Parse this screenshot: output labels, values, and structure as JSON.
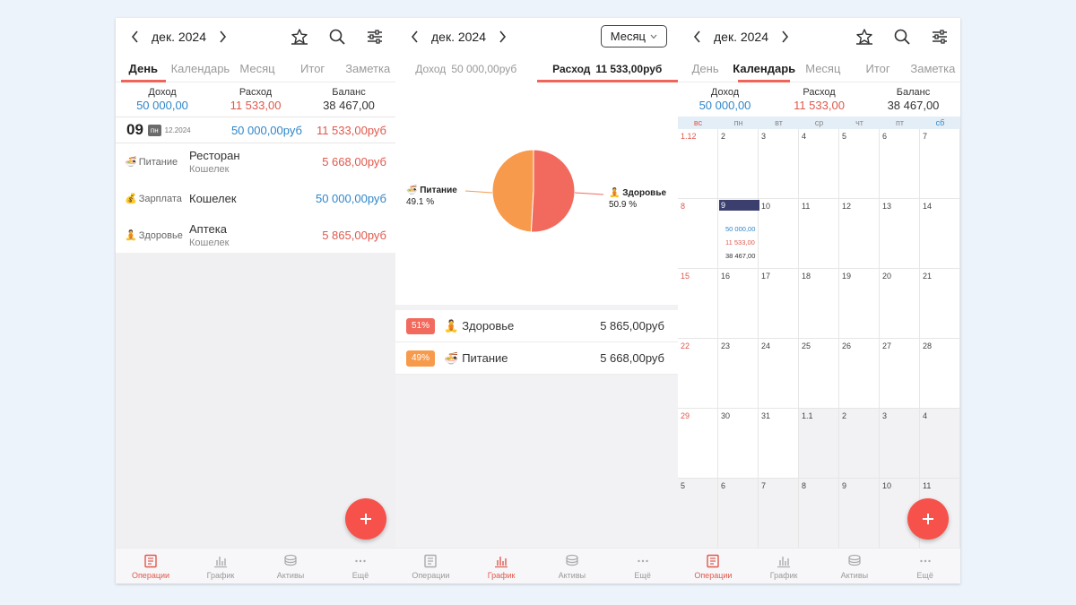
{
  "s1": {
    "month": "дек. 2024",
    "tabs": [
      "День",
      "Календарь",
      "Месяц",
      "Итог",
      "Заметка"
    ],
    "summary": {
      "income_label": "Доход",
      "income": "50 000,00",
      "expense_label": "Расход",
      "expense": "11 533,00",
      "balance_label": "Баланс",
      "balance": "38 467,00"
    },
    "day": {
      "num": "09",
      "weekday": "пн",
      "date": "12.2024",
      "income": "50 000,00руб",
      "expense": "11 533,00руб"
    },
    "transactions": [
      {
        "emoji": "🍜",
        "category": "Питание",
        "title": "Ресторан",
        "account": "Кошелек",
        "amount": "5 668,00руб",
        "type": "expense"
      },
      {
        "emoji": "💰",
        "category": "Зарплата",
        "title": "Кошелек",
        "account": "",
        "amount": "50 000,00руб",
        "type": "income"
      },
      {
        "emoji": "🧘",
        "category": "Здоровье",
        "title": "Аптека",
        "account": "Кошелек",
        "amount": "5 865,00руб",
        "type": "expense"
      }
    ]
  },
  "s2": {
    "month": "дек. 2024",
    "period": "Месяц",
    "income_tab_label": "Доход",
    "income_tab_value": "50 000,00руб",
    "expense_tab_label": "Расход",
    "expense_tab_value": "11 533,00руб",
    "pie": [
      {
        "emoji": "🍜",
        "name": "Питание",
        "pct_label": "49.1 %",
        "value": 49.1,
        "color": "#f79a4c"
      },
      {
        "emoji": "🧘",
        "name": "Здоровье",
        "pct_label": "50.9 %",
        "value": 50.9,
        "color": "#f26a5e"
      }
    ],
    "categories": [
      {
        "pct": "51%",
        "emoji": "🧘",
        "name": "Здоровье",
        "amount": "5 865,00руб",
        "color": "#f26a5e"
      },
      {
        "pct": "49%",
        "emoji": "🍜",
        "name": "Питание",
        "amount": "5 668,00руб",
        "color": "#f79a4c"
      }
    ]
  },
  "s3": {
    "month": "дек. 2024",
    "tabs": [
      "День",
      "Календарь",
      "Месяц",
      "Итог",
      "Заметка"
    ],
    "summary": {
      "income_label": "Доход",
      "income": "50 000,00",
      "expense_label": "Расход",
      "expense": "11 533,00",
      "balance_label": "Баланс",
      "balance": "38 467,00"
    },
    "weekdays": [
      "вс",
      "пн",
      "вт",
      "ср",
      "чт",
      "пт",
      "сб"
    ],
    "weeks": [
      [
        "1.12",
        "2",
        "3",
        "4",
        "5",
        "6",
        "7"
      ],
      [
        "8",
        "9",
        "10",
        "11",
        "12",
        "13",
        "14"
      ],
      [
        "15",
        "16",
        "17",
        "18",
        "19",
        "20",
        "21"
      ],
      [
        "22",
        "23",
        "24",
        "25",
        "26",
        "27",
        "28"
      ],
      [
        "29",
        "30",
        "31",
        "1.1",
        "2",
        "3",
        "4"
      ],
      [
        "5",
        "6",
        "7",
        "8",
        "9",
        "10",
        "11"
      ]
    ],
    "selected_day": {
      "income": "50 000,00",
      "expense": "11 533,00",
      "balance": "38 467,00"
    }
  },
  "nav": [
    "Операции",
    "График",
    "Активы",
    "Ещё"
  ],
  "colors": {
    "accent": "#f0645a",
    "income": "#2f86c9",
    "expense": "#e0584c",
    "fab": "#f6524b",
    "selected_day": "#3a3f6e"
  }
}
